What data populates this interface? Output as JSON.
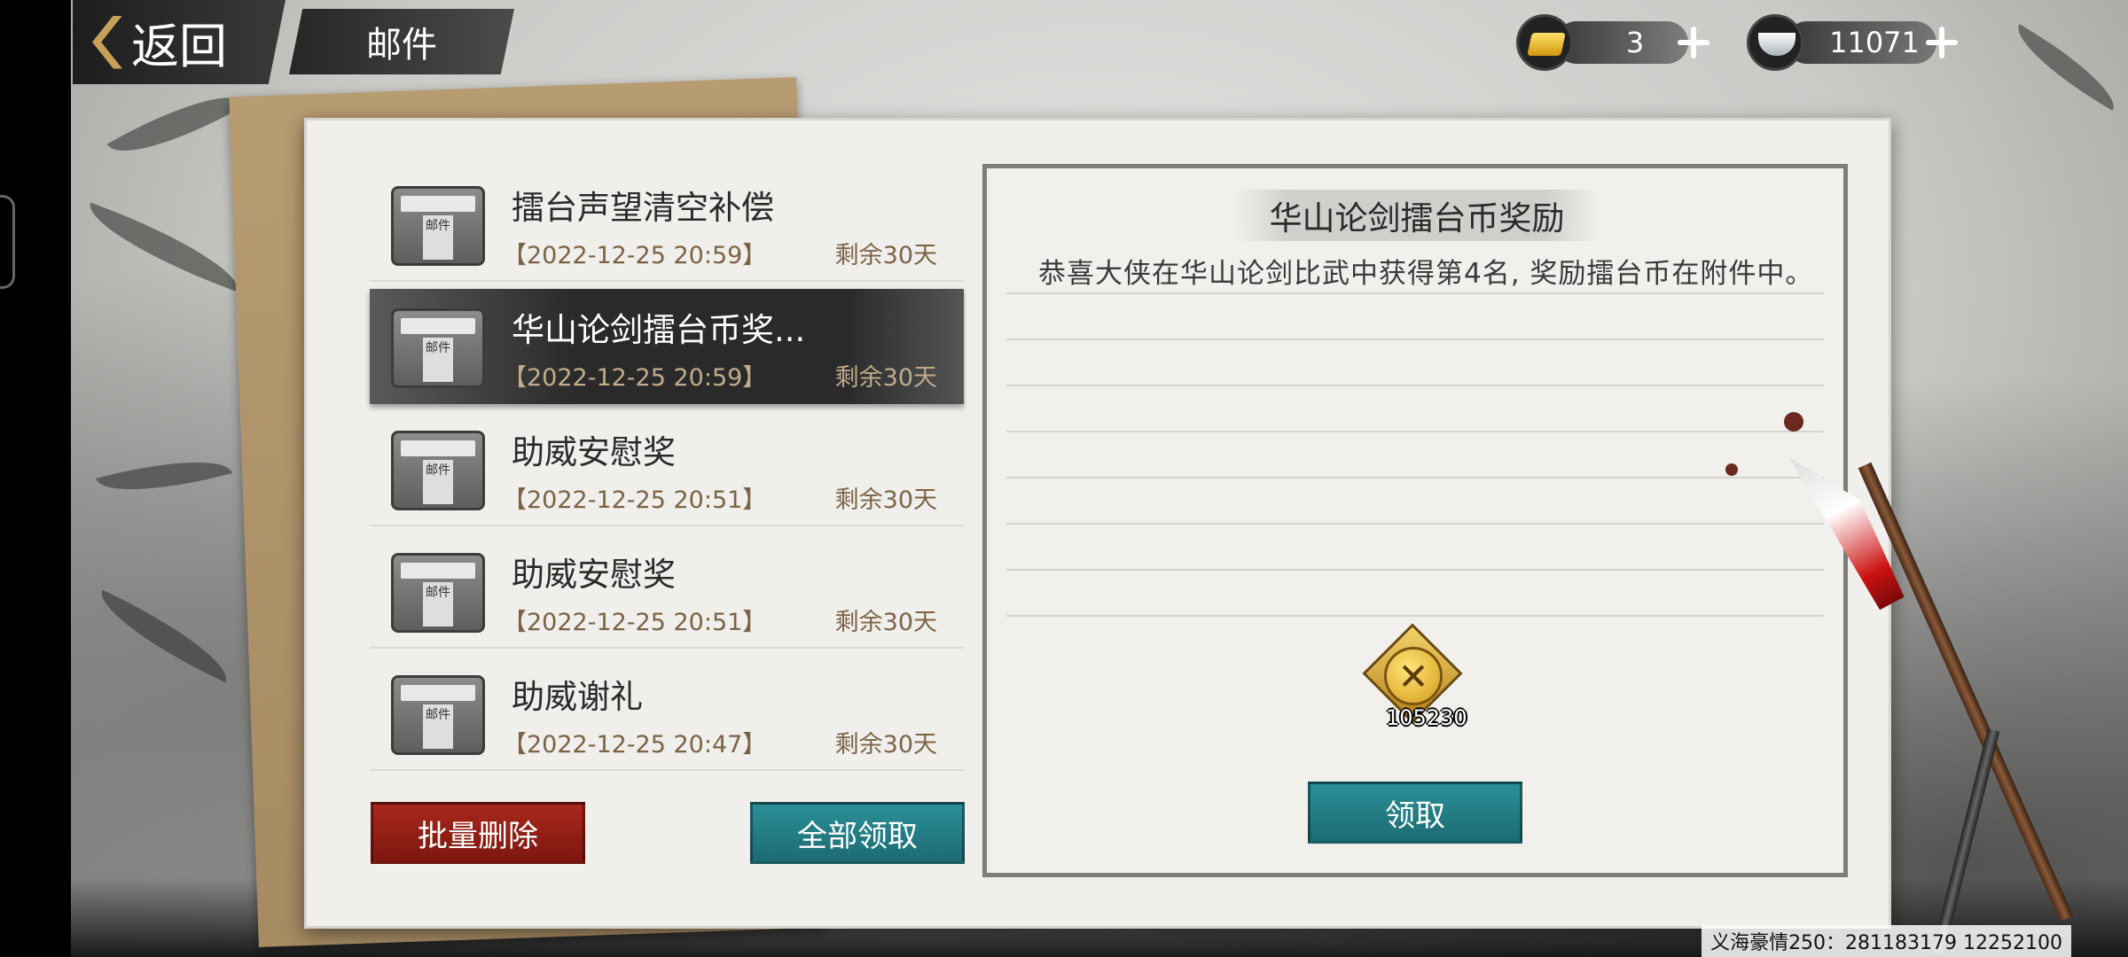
{
  "header": {
    "back_label": "返回",
    "title": "邮件"
  },
  "currency": {
    "gold": {
      "icon": "gold-ingot-icon",
      "value": "3"
    },
    "silver": {
      "icon": "silver-ingot-icon",
      "value": "11071"
    }
  },
  "mail_list": [
    {
      "title": "擂台声望清空补偿",
      "date": "【2022-12-25  20:59】",
      "remaining": "剩余30天",
      "selected": false,
      "icon_text": "邮件"
    },
    {
      "title": "华山论剑擂台币奖...",
      "date": "【2022-12-25  20:59】",
      "remaining": "剩余30天",
      "selected": true,
      "icon_text": "邮件"
    },
    {
      "title": "助威安慰奖",
      "date": "【2022-12-25  20:51】",
      "remaining": "剩余30天",
      "selected": false,
      "icon_text": "邮件"
    },
    {
      "title": "助威安慰奖",
      "date": "【2022-12-25  20:51】",
      "remaining": "剩余30天",
      "selected": false,
      "icon_text": "邮件"
    },
    {
      "title": "助威谢礼",
      "date": "【2022-12-25  20:47】",
      "remaining": "剩余30天",
      "selected": false,
      "icon_text": "邮件"
    }
  ],
  "buttons": {
    "batch_delete": "批量删除",
    "claim_all": "全部领取",
    "claim": "领取"
  },
  "detail": {
    "title": "华山论剑擂台币奖励",
    "body": "恭喜大侠在华山论剑比武中获得第4名, 奖励擂台币在附件中。",
    "reward": {
      "icon": "arena-coin-icon",
      "count": "105230"
    }
  },
  "watermark": "义海豪情250：281183179  12252100",
  "colors": {
    "delete_button": "#9a2218",
    "claim_button": "#237d86",
    "selected_row": "#2a2a2a",
    "date_text": "#7a6346"
  }
}
